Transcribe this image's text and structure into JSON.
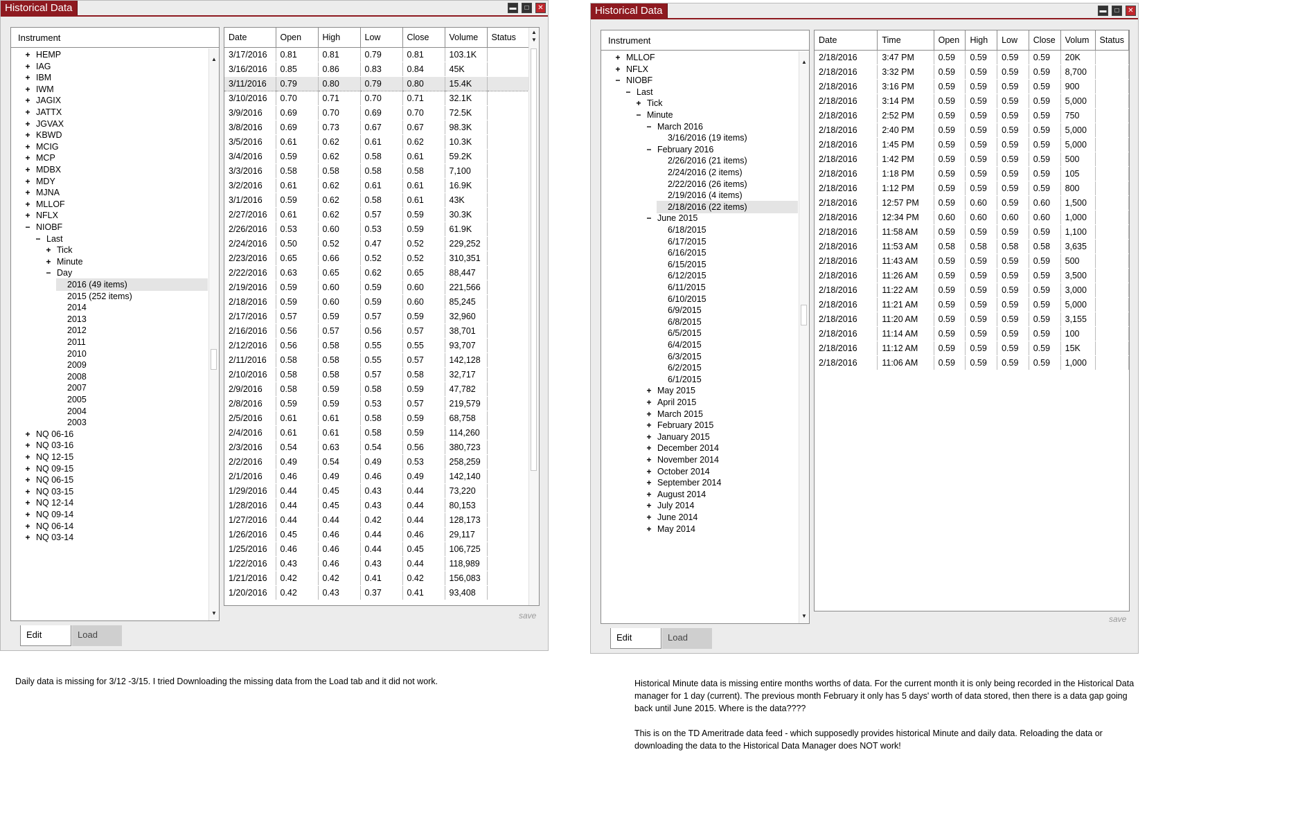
{
  "left_window": {
    "title": "Historical Data",
    "instrument_header": "Instrument",
    "tree": [
      {
        "label": "HEMP",
        "level": 0,
        "exp": "+"
      },
      {
        "label": "IAG",
        "level": 0,
        "exp": "+"
      },
      {
        "label": "IBM",
        "level": 0,
        "exp": "+"
      },
      {
        "label": "IWM",
        "level": 0,
        "exp": "+"
      },
      {
        "label": "JAGIX",
        "level": 0,
        "exp": "+"
      },
      {
        "label": "JATTX",
        "level": 0,
        "exp": "+"
      },
      {
        "label": "JGVAX",
        "level": 0,
        "exp": "+"
      },
      {
        "label": "KBWD",
        "level": 0,
        "exp": "+"
      },
      {
        "label": "MCIG",
        "level": 0,
        "exp": "+"
      },
      {
        "label": "MCP",
        "level": 0,
        "exp": "+"
      },
      {
        "label": "MDBX",
        "level": 0,
        "exp": "+"
      },
      {
        "label": "MDY",
        "level": 0,
        "exp": "+"
      },
      {
        "label": "MJNA",
        "level": 0,
        "exp": "+"
      },
      {
        "label": "MLLOF",
        "level": 0,
        "exp": "+"
      },
      {
        "label": "NFLX",
        "level": 0,
        "exp": "+"
      },
      {
        "label": "NIOBF",
        "level": 0,
        "exp": "−"
      },
      {
        "label": "Last",
        "level": 1,
        "exp": "−"
      },
      {
        "label": "Tick",
        "level": 2,
        "exp": "+"
      },
      {
        "label": "Minute",
        "level": 2,
        "exp": "+"
      },
      {
        "label": "Day",
        "level": 2,
        "exp": "−"
      },
      {
        "label": "2016 (49 items)",
        "level": 3,
        "exp": "",
        "selected": true
      },
      {
        "label": "2015 (252 items)",
        "level": 3,
        "exp": ""
      },
      {
        "label": "2014",
        "level": 3,
        "exp": ""
      },
      {
        "label": "2013",
        "level": 3,
        "exp": ""
      },
      {
        "label": "2012",
        "level": 3,
        "exp": ""
      },
      {
        "label": "2011",
        "level": 3,
        "exp": ""
      },
      {
        "label": "2010",
        "level": 3,
        "exp": ""
      },
      {
        "label": "2009",
        "level": 3,
        "exp": ""
      },
      {
        "label": "2008",
        "level": 3,
        "exp": ""
      },
      {
        "label": "2007",
        "level": 3,
        "exp": ""
      },
      {
        "label": "2005",
        "level": 3,
        "exp": ""
      },
      {
        "label": "2004",
        "level": 3,
        "exp": ""
      },
      {
        "label": "2003",
        "level": 3,
        "exp": ""
      },
      {
        "label": "NQ 06-16",
        "level": 0,
        "exp": "+"
      },
      {
        "label": "NQ 03-16",
        "level": 0,
        "exp": "+"
      },
      {
        "label": "NQ 12-15",
        "level": 0,
        "exp": "+"
      },
      {
        "label": "NQ 09-15",
        "level": 0,
        "exp": "+"
      },
      {
        "label": "NQ 06-15",
        "level": 0,
        "exp": "+"
      },
      {
        "label": "NQ 03-15",
        "level": 0,
        "exp": "+"
      },
      {
        "label": "NQ 12-14",
        "level": 0,
        "exp": "+"
      },
      {
        "label": "NQ 09-14",
        "level": 0,
        "exp": "+"
      },
      {
        "label": "NQ 06-14",
        "level": 0,
        "exp": "+"
      },
      {
        "label": "NQ 03-14",
        "level": 0,
        "exp": "+"
      }
    ],
    "columns": [
      "Date",
      "Open",
      "High",
      "Low",
      "Close",
      "Volume",
      "Status"
    ],
    "rows": [
      [
        "3/17/2016",
        "0.81",
        "0.81",
        "0.79",
        "0.81",
        "103.1K",
        ""
      ],
      [
        "3/16/2016",
        "0.85",
        "0.86",
        "0.83",
        "0.84",
        "45K",
        ""
      ],
      [
        "3/11/2016",
        "0.79",
        "0.80",
        "0.79",
        "0.80",
        "15.4K",
        ""
      ],
      [
        "3/10/2016",
        "0.70",
        "0.71",
        "0.70",
        "0.71",
        "32.1K",
        ""
      ],
      [
        "3/9/2016",
        "0.69",
        "0.70",
        "0.69",
        "0.70",
        "72.5K",
        ""
      ],
      [
        "3/8/2016",
        "0.69",
        "0.73",
        "0.67",
        "0.67",
        "98.3K",
        ""
      ],
      [
        "3/5/2016",
        "0.61",
        "0.62",
        "0.61",
        "0.62",
        "10.3K",
        ""
      ],
      [
        "3/4/2016",
        "0.59",
        "0.62",
        "0.58",
        "0.61",
        "59.2K",
        ""
      ],
      [
        "3/3/2016",
        "0.58",
        "0.58",
        "0.58",
        "0.58",
        "7,100",
        ""
      ],
      [
        "3/2/2016",
        "0.61",
        "0.62",
        "0.61",
        "0.61",
        "16.9K",
        ""
      ],
      [
        "3/1/2016",
        "0.59",
        "0.62",
        "0.58",
        "0.61",
        "43K",
        ""
      ],
      [
        "2/27/2016",
        "0.61",
        "0.62",
        "0.57",
        "0.59",
        "30.3K",
        ""
      ],
      [
        "2/26/2016",
        "0.53",
        "0.60",
        "0.53",
        "0.59",
        "61.9K",
        ""
      ],
      [
        "2/24/2016",
        "0.50",
        "0.52",
        "0.47",
        "0.52",
        "229,252",
        ""
      ],
      [
        "2/23/2016",
        "0.65",
        "0.66",
        "0.52",
        "0.52",
        "310,351",
        ""
      ],
      [
        "2/22/2016",
        "0.63",
        "0.65",
        "0.62",
        "0.65",
        "88,447",
        ""
      ],
      [
        "2/19/2016",
        "0.59",
        "0.60",
        "0.59",
        "0.60",
        "221,566",
        ""
      ],
      [
        "2/18/2016",
        "0.59",
        "0.60",
        "0.59",
        "0.60",
        "85,245",
        ""
      ],
      [
        "2/17/2016",
        "0.57",
        "0.59",
        "0.57",
        "0.59",
        "32,960",
        ""
      ],
      [
        "2/16/2016",
        "0.56",
        "0.57",
        "0.56",
        "0.57",
        "38,701",
        ""
      ],
      [
        "2/12/2016",
        "0.56",
        "0.58",
        "0.55",
        "0.55",
        "93,707",
        ""
      ],
      [
        "2/11/2016",
        "0.58",
        "0.58",
        "0.55",
        "0.57",
        "142,128",
        ""
      ],
      [
        "2/10/2016",
        "0.58",
        "0.58",
        "0.57",
        "0.58",
        "32,717",
        ""
      ],
      [
        "2/9/2016",
        "0.58",
        "0.59",
        "0.58",
        "0.59",
        "47,782",
        ""
      ],
      [
        "2/8/2016",
        "0.59",
        "0.59",
        "0.53",
        "0.57",
        "219,579",
        ""
      ],
      [
        "2/5/2016",
        "0.61",
        "0.61",
        "0.58",
        "0.59",
        "68,758",
        ""
      ],
      [
        "2/4/2016",
        "0.61",
        "0.61",
        "0.58",
        "0.59",
        "114,260",
        ""
      ],
      [
        "2/3/2016",
        "0.54",
        "0.63",
        "0.54",
        "0.56",
        "380,723",
        ""
      ],
      [
        "2/2/2016",
        "0.49",
        "0.54",
        "0.49",
        "0.53",
        "258,259",
        ""
      ],
      [
        "2/1/2016",
        "0.46",
        "0.49",
        "0.46",
        "0.49",
        "142,140",
        ""
      ],
      [
        "1/29/2016",
        "0.44",
        "0.45",
        "0.43",
        "0.44",
        "73,220",
        ""
      ],
      [
        "1/28/2016",
        "0.44",
        "0.45",
        "0.43",
        "0.44",
        "80,153",
        ""
      ],
      [
        "1/27/2016",
        "0.44",
        "0.44",
        "0.42",
        "0.44",
        "128,173",
        ""
      ],
      [
        "1/26/2016",
        "0.45",
        "0.46",
        "0.44",
        "0.46",
        "29,117",
        ""
      ],
      [
        "1/25/2016",
        "0.46",
        "0.46",
        "0.44",
        "0.45",
        "106,725",
        ""
      ],
      [
        "1/22/2016",
        "0.43",
        "0.46",
        "0.43",
        "0.44",
        "118,989",
        ""
      ],
      [
        "1/21/2016",
        "0.42",
        "0.42",
        "0.41",
        "0.42",
        "156,083",
        ""
      ],
      [
        "1/20/2016",
        "0.42",
        "0.43",
        "0.37",
        "0.41",
        "93,408",
        ""
      ]
    ],
    "selected_row": 2,
    "save_label": "save",
    "tab_edit": "Edit",
    "tab_load": "Load"
  },
  "right_window": {
    "title": "Historical Data",
    "instrument_header": "Instrument",
    "tree": [
      {
        "label": "MLLOF",
        "level": 0,
        "exp": "+"
      },
      {
        "label": "NFLX",
        "level": 0,
        "exp": "+"
      },
      {
        "label": "NIOBF",
        "level": 0,
        "exp": "−"
      },
      {
        "label": "Last",
        "level": 1,
        "exp": "−"
      },
      {
        "label": "Tick",
        "level": 2,
        "exp": "+"
      },
      {
        "label": "Minute",
        "level": 2,
        "exp": "−"
      },
      {
        "label": "March 2016",
        "level": 3,
        "exp": "−"
      },
      {
        "label": "3/16/2016 (19 items)",
        "level": 4,
        "exp": ""
      },
      {
        "label": "February 2016",
        "level": 3,
        "exp": "−"
      },
      {
        "label": "2/26/2016 (21 items)",
        "level": 4,
        "exp": ""
      },
      {
        "label": "2/24/2016 (2 items)",
        "level": 4,
        "exp": ""
      },
      {
        "label": "2/22/2016 (26 items)",
        "level": 4,
        "exp": ""
      },
      {
        "label": "2/19/2016 (4 items)",
        "level": 4,
        "exp": ""
      },
      {
        "label": "2/18/2016 (22 items)",
        "level": 4,
        "exp": "",
        "selected": true
      },
      {
        "label": "June 2015",
        "level": 3,
        "exp": "−"
      },
      {
        "label": "6/18/2015",
        "level": 4,
        "exp": ""
      },
      {
        "label": "6/17/2015",
        "level": 4,
        "exp": ""
      },
      {
        "label": "6/16/2015",
        "level": 4,
        "exp": ""
      },
      {
        "label": "6/15/2015",
        "level": 4,
        "exp": ""
      },
      {
        "label": "6/12/2015",
        "level": 4,
        "exp": ""
      },
      {
        "label": "6/11/2015",
        "level": 4,
        "exp": ""
      },
      {
        "label": "6/10/2015",
        "level": 4,
        "exp": ""
      },
      {
        "label": "6/9/2015",
        "level": 4,
        "exp": ""
      },
      {
        "label": "6/8/2015",
        "level": 4,
        "exp": ""
      },
      {
        "label": "6/5/2015",
        "level": 4,
        "exp": ""
      },
      {
        "label": "6/4/2015",
        "level": 4,
        "exp": ""
      },
      {
        "label": "6/3/2015",
        "level": 4,
        "exp": ""
      },
      {
        "label": "6/2/2015",
        "level": 4,
        "exp": ""
      },
      {
        "label": "6/1/2015",
        "level": 4,
        "exp": ""
      },
      {
        "label": "May 2015",
        "level": 3,
        "exp": "+"
      },
      {
        "label": "April 2015",
        "level": 3,
        "exp": "+"
      },
      {
        "label": "March 2015",
        "level": 3,
        "exp": "+"
      },
      {
        "label": "February 2015",
        "level": 3,
        "exp": "+"
      },
      {
        "label": "January 2015",
        "level": 3,
        "exp": "+"
      },
      {
        "label": "December 2014",
        "level": 3,
        "exp": "+"
      },
      {
        "label": "November 2014",
        "level": 3,
        "exp": "+"
      },
      {
        "label": "October 2014",
        "level": 3,
        "exp": "+"
      },
      {
        "label": "September 2014",
        "level": 3,
        "exp": "+"
      },
      {
        "label": "August 2014",
        "level": 3,
        "exp": "+"
      },
      {
        "label": "July 2014",
        "level": 3,
        "exp": "+"
      },
      {
        "label": "June 2014",
        "level": 3,
        "exp": "+"
      },
      {
        "label": "May 2014",
        "level": 3,
        "exp": "+"
      }
    ],
    "columns": [
      "Date",
      "Time",
      "Open",
      "High",
      "Low",
      "Close",
      "Volum",
      "Status"
    ],
    "rows": [
      [
        "2/18/2016",
        "3:47 PM",
        "0.59",
        "0.59",
        "0.59",
        "0.59",
        "20K",
        ""
      ],
      [
        "2/18/2016",
        "3:32 PM",
        "0.59",
        "0.59",
        "0.59",
        "0.59",
        "8,700",
        ""
      ],
      [
        "2/18/2016",
        "3:16 PM",
        "0.59",
        "0.59",
        "0.59",
        "0.59",
        "900",
        ""
      ],
      [
        "2/18/2016",
        "3:14 PM",
        "0.59",
        "0.59",
        "0.59",
        "0.59",
        "5,000",
        ""
      ],
      [
        "2/18/2016",
        "2:52 PM",
        "0.59",
        "0.59",
        "0.59",
        "0.59",
        "750",
        ""
      ],
      [
        "2/18/2016",
        "2:40 PM",
        "0.59",
        "0.59",
        "0.59",
        "0.59",
        "5,000",
        ""
      ],
      [
        "2/18/2016",
        "1:45 PM",
        "0.59",
        "0.59",
        "0.59",
        "0.59",
        "5,000",
        ""
      ],
      [
        "2/18/2016",
        "1:42 PM",
        "0.59",
        "0.59",
        "0.59",
        "0.59",
        "500",
        ""
      ],
      [
        "2/18/2016",
        "1:18 PM",
        "0.59",
        "0.59",
        "0.59",
        "0.59",
        "105",
        ""
      ],
      [
        "2/18/2016",
        "1:12 PM",
        "0.59",
        "0.59",
        "0.59",
        "0.59",
        "800",
        ""
      ],
      [
        "2/18/2016",
        "12:57 PM",
        "0.59",
        "0.60",
        "0.59",
        "0.60",
        "1,500",
        ""
      ],
      [
        "2/18/2016",
        "12:34 PM",
        "0.60",
        "0.60",
        "0.60",
        "0.60",
        "1,000",
        ""
      ],
      [
        "2/18/2016",
        "11:58 AM",
        "0.59",
        "0.59",
        "0.59",
        "0.59",
        "1,100",
        ""
      ],
      [
        "2/18/2016",
        "11:53 AM",
        "0.58",
        "0.58",
        "0.58",
        "0.58",
        "3,635",
        ""
      ],
      [
        "2/18/2016",
        "11:43 AM",
        "0.59",
        "0.59",
        "0.59",
        "0.59",
        "500",
        ""
      ],
      [
        "2/18/2016",
        "11:26 AM",
        "0.59",
        "0.59",
        "0.59",
        "0.59",
        "3,500",
        ""
      ],
      [
        "2/18/2016",
        "11:22 AM",
        "0.59",
        "0.59",
        "0.59",
        "0.59",
        "3,000",
        ""
      ],
      [
        "2/18/2016",
        "11:21 AM",
        "0.59",
        "0.59",
        "0.59",
        "0.59",
        "5,000",
        ""
      ],
      [
        "2/18/2016",
        "11:20 AM",
        "0.59",
        "0.59",
        "0.59",
        "0.59",
        "3,155",
        ""
      ],
      [
        "2/18/2016",
        "11:14 AM",
        "0.59",
        "0.59",
        "0.59",
        "0.59",
        "100",
        ""
      ],
      [
        "2/18/2016",
        "11:12 AM",
        "0.59",
        "0.59",
        "0.59",
        "0.59",
        "15K",
        ""
      ],
      [
        "2/18/2016",
        "11:06 AM",
        "0.59",
        "0.59",
        "0.59",
        "0.59",
        "1,000",
        ""
      ]
    ],
    "save_label": "save",
    "tab_edit": "Edit",
    "tab_load": "Load"
  },
  "notes": {
    "left": "Daily data is missing for 3/12 -3/15.  I tried Downloading the missing data from the Load tab and it did not work.",
    "right_p1": "Historical Minute data is missing entire months worths of data.  For the current month it is only being recorded in the Historical Data manager for 1 day (current).  The previous month February it only has 5 days' worth of data stored, then there is a data gap going back until June 2015.   Where is the data????",
    "right_p2": "This is on the TD Ameritrade data feed - which supposedly provides historical Minute and daily data.  Reloading the data or downloading the data to the Historical Data Manager does NOT work!"
  },
  "colors": {
    "title_bar": "#8e1a20",
    "selected_row": "#e7e7e7"
  },
  "icons": [
    "minimize-icon",
    "maximize-icon",
    "close-icon",
    "expand-plus-icon",
    "collapse-minus-icon",
    "scroll-up-arrow-icon",
    "scroll-down-arrow-icon"
  ]
}
